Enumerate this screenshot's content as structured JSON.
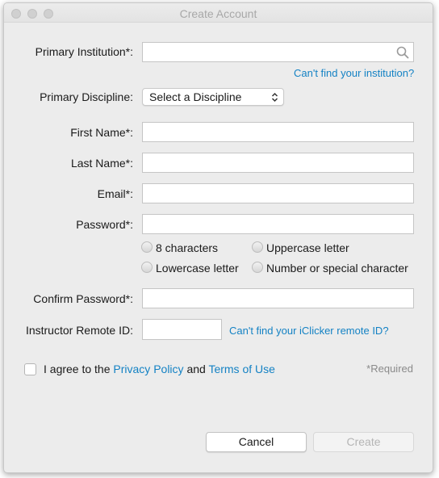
{
  "window": {
    "title": "Create Account"
  },
  "institution": {
    "label": "Primary Institution*:",
    "value": "",
    "help_link": "Can't find your institution?"
  },
  "discipline": {
    "label": "Primary Discipline:",
    "selected": "Select a Discipline"
  },
  "first_name": {
    "label": "First Name*:",
    "value": ""
  },
  "last_name": {
    "label": "Last Name*:",
    "value": ""
  },
  "email": {
    "label": "Email*:",
    "value": ""
  },
  "password": {
    "label": "Password*:",
    "value": "",
    "requirements": [
      "8 characters",
      "Uppercase letter",
      "Lowercase letter",
      "Number or special character"
    ]
  },
  "confirm_password": {
    "label": "Confirm Password*:",
    "value": ""
  },
  "remote_id": {
    "label": "Instructor Remote ID:",
    "value": "",
    "help_link": "Can't find your iClicker remote ID?"
  },
  "agreement": {
    "prefix": "I agree to the",
    "privacy": "Privacy Policy",
    "and": "and",
    "terms": "Terms of Use",
    "checked": false
  },
  "required_note": "*Required",
  "buttons": {
    "cancel": "Cancel",
    "create": "Create"
  },
  "colors": {
    "link": "#1482c4",
    "background": "#ececec"
  }
}
